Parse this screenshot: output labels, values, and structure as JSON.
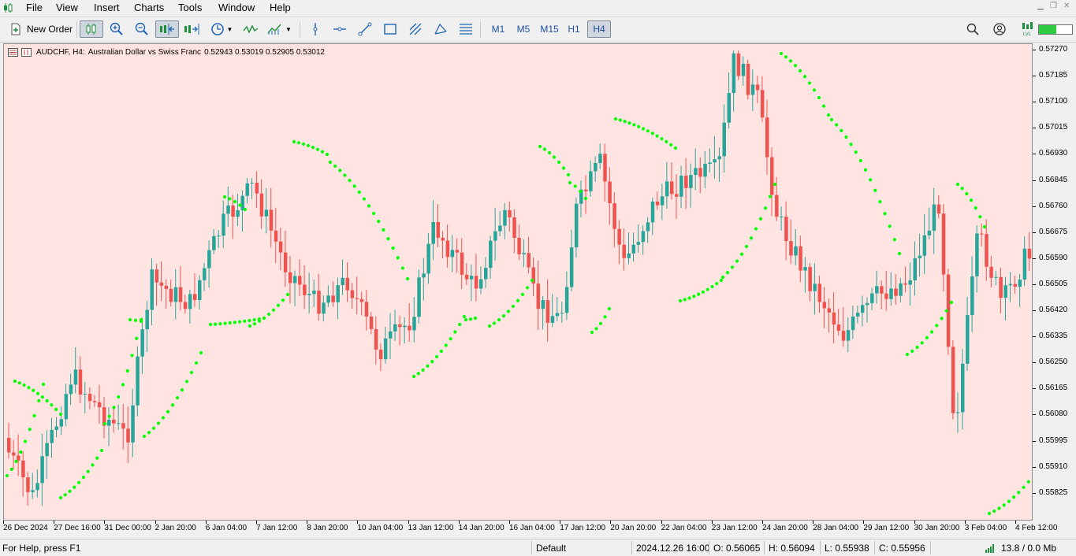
{
  "menu": [
    "File",
    "View",
    "Insert",
    "Charts",
    "Tools",
    "Window",
    "Help"
  ],
  "toolbar": {
    "new_order": "New Order",
    "timeframes": [
      "M1",
      "M5",
      "M15",
      "H1",
      "H4"
    ],
    "active_timeframe": "H4"
  },
  "chart": {
    "symbol": "AUDCHF, H4:",
    "description": "Australian Dollar vs Swiss Franc",
    "ohlc": "0.52943 0.53019 0.52905 0.53012",
    "background": "#ffe4e1",
    "bull_color": "#26a69a",
    "bear_color": "#ef5350",
    "sar_color": "#00ff00"
  },
  "y_axis": [
    "0.57270",
    "0.57185",
    "0.57100",
    "0.57015",
    "0.56930",
    "0.56845",
    "0.56760",
    "0.56675",
    "0.56590",
    "0.56505",
    "0.56420",
    "0.56335",
    "0.56250",
    "0.56165",
    "0.56080",
    "0.55995",
    "0.55910",
    "0.55825"
  ],
  "x_axis": [
    "26 Dec 2024",
    "27 Dec 16:00",
    "31 Dec 00:00",
    "2 Jan 20:00",
    "6 Jan 04:00",
    "7 Jan 12:00",
    "8 Jan 20:00",
    "10 Jan 04:00",
    "13 Jan 12:00",
    "14 Jan 20:00",
    "16 Jan 04:00",
    "17 Jan 12:00",
    "20 Jan 20:00",
    "22 Jan 04:00",
    "23 Jan 12:00",
    "24 Jan 20:00",
    "28 Jan 04:00",
    "29 Jan 12:00",
    "30 Jan 20:00",
    "3 Feb 04:00",
    "4 Feb 12:00"
  ],
  "status": {
    "help": "For Help, press F1",
    "profile": "Default",
    "datetime": "2024.12.26 16:00",
    "open": "O: 0.56065",
    "high": "H: 0.56094",
    "low": "L: 0.55938",
    "close": "C: 0.55956",
    "traffic": "13.8 / 0.0 Mb"
  }
}
